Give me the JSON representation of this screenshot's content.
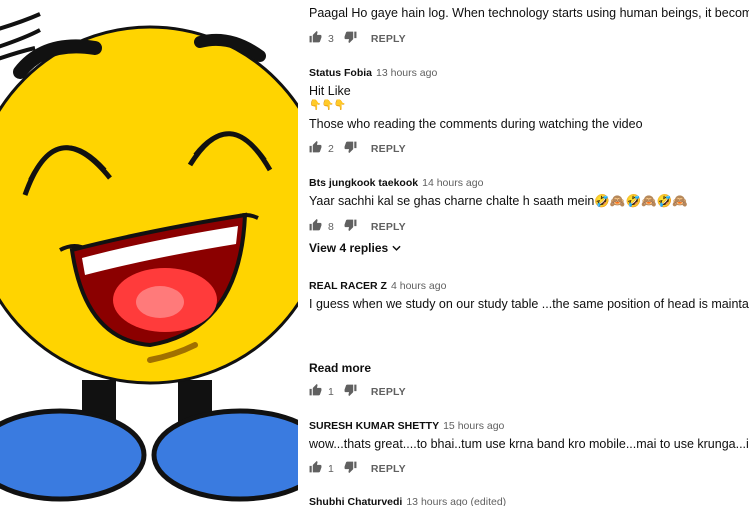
{
  "comments": [
    {
      "author": "",
      "time": "",
      "lines": [
        "Paagal Ho gaye hain log. When technology starts using human beings, it becomes a so"
      ],
      "likes": "3",
      "reply_label": "REPLY"
    },
    {
      "author": "Status Fobia",
      "time": "13 hours ago",
      "lines": [
        "Hit Like",
        "👇👇👇",
        "Those who reading the comments during watching the video"
      ],
      "likes": "2",
      "reply_label": "REPLY"
    },
    {
      "author": "Bts jungkook taekook",
      "time": "14 hours ago",
      "lines": [
        "Yaar sachhi kal se ghas charne chalte h saath mein🤣🙈🤣🙈🤣🙈"
      ],
      "likes": "8",
      "reply_label": "REPLY",
      "view_replies": "View 4 replies"
    },
    {
      "author": "REAL RACER Z",
      "time": "4 hours ago",
      "lines": [
        "I guess when we study on our study table ...the same position of head is maintained ..."
      ],
      "read_more": "Read more",
      "likes": "1",
      "reply_label": "REPLY"
    },
    {
      "author": "SURESH KUMAR SHETTY",
      "time": "15 hours ago",
      "lines": [
        "wow...thats great....to bhai..tum use krna band kro mobile...mai to use krunga...i am co"
      ],
      "likes": "1",
      "reply_label": "REPLY"
    },
    {
      "author": "Shubhi Chaturvedi",
      "time": "13 hours ago (edited)"
    }
  ],
  "icons": {
    "like": "thumbs-up-icon",
    "dislike": "thumbs-down-icon",
    "expand": "chevron-down-icon"
  },
  "colors": {
    "face": "#ffd400",
    "mouth": "#8b0000",
    "tongue": "#ff3b3b",
    "feet": "#3a7be0",
    "meta_text": "#606060"
  }
}
